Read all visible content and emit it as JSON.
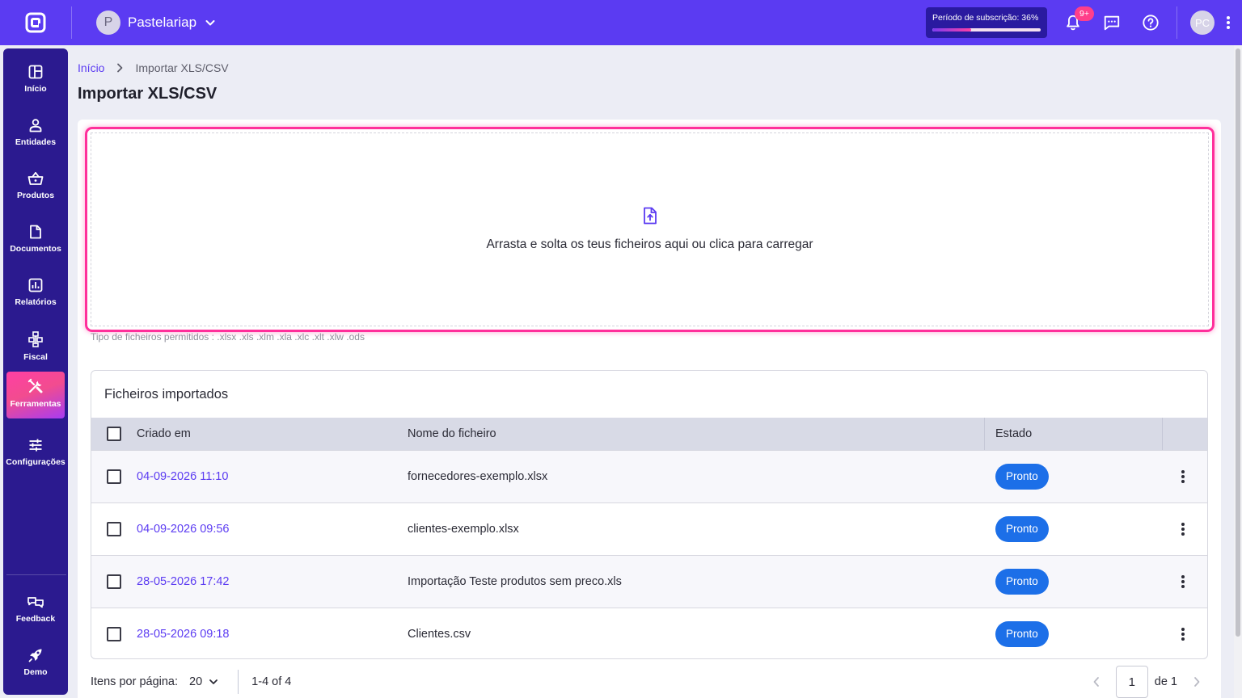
{
  "topbar": {
    "company_initial": "P",
    "company_name": "Pastelariap",
    "subscription_label": "Período de subscrição: 36%",
    "subscription_progress": 0.36,
    "notifications_badge": "9+",
    "user_initials": "PC"
  },
  "sidebar": {
    "items": [
      {
        "label": "Início",
        "icon": "dashboard-icon"
      },
      {
        "label": "Entidades",
        "icon": "person-icon"
      },
      {
        "label": "Produtos",
        "icon": "basket-icon"
      },
      {
        "label": "Documentos",
        "icon": "document-icon"
      },
      {
        "label": "Relatórios",
        "icon": "chart-icon"
      },
      {
        "label": "Fiscal",
        "icon": "hierarchy-icon"
      },
      {
        "label": "Ferramentas",
        "icon": "tools-icon",
        "active": true
      },
      {
        "label": "Configurações",
        "icon": "sliders-icon"
      }
    ],
    "bottom_items": [
      {
        "label": "Feedback",
        "icon": "feedback-icon"
      },
      {
        "label": "Demo",
        "icon": "rocket-icon"
      }
    ]
  },
  "breadcrumb": {
    "home": "Início",
    "current": "Importar XLS/CSV"
  },
  "page_title": "Importar XLS/CSV",
  "dropzone": {
    "text": "Arrasta e solta os teus ficheiros aqui ou clica para carregar",
    "allowed_types": "Tipo de ficheiros permitidos : .xlsx .xls .xlm .xla .xlc .xlt .xlw .ods"
  },
  "table": {
    "title": "Ficheiros importados",
    "headers": {
      "created": "Criado em",
      "filename": "Nome do ficheiro",
      "state": "Estado"
    },
    "rows": [
      {
        "created": "04-09-2026 11:10",
        "filename": "fornecedores-exemplo.xlsx",
        "state": "Pronto"
      },
      {
        "created": "04-09-2026 09:56",
        "filename": "clientes-exemplo.xlsx",
        "state": "Pronto"
      },
      {
        "created": "28-05-2026 17:42",
        "filename": "Importação Teste produtos sem preco.xls",
        "state": "Pronto"
      },
      {
        "created": "28-05-2026 09:18",
        "filename": "Clientes.csv",
        "state": "Pronto"
      }
    ]
  },
  "paginator": {
    "items_per_page_label": "Itens por página:",
    "items_per_page": "20",
    "range": "1-4 of 4",
    "page": "1",
    "of_total": "de 1"
  },
  "colors": {
    "brand": "#5b3bf2",
    "sidebar": "#2b1a8f",
    "accent_pink": "#ff2f9b",
    "status_ready": "#1c6fe8"
  }
}
